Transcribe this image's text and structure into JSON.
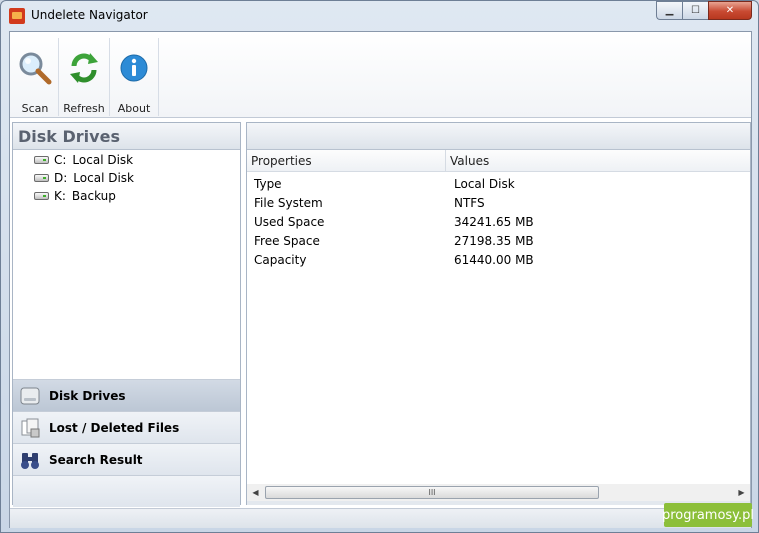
{
  "window": {
    "title": "Undelete Navigator",
    "caption_buttons": {
      "minimize": "▁",
      "maximize": "☐",
      "close": "✕"
    }
  },
  "toolbar": {
    "buttons": [
      {
        "label": "Scan",
        "icon": "magnifier-icon"
      },
      {
        "label": "Refresh",
        "icon": "refresh-icon"
      },
      {
        "label": "About",
        "icon": "info-icon"
      }
    ]
  },
  "left_panel": {
    "header": "Disk Drives",
    "drives": [
      {
        "letter": "C:",
        "name": "Local Disk",
        "icon": "drive-icon"
      },
      {
        "letter": "D:",
        "name": "Local Disk",
        "icon": "drive-icon"
      },
      {
        "letter": "K:",
        "name": "Backup",
        "icon": "drive-icon"
      }
    ],
    "nav": [
      {
        "label": "Disk Drives",
        "icon": "disk-drives-icon",
        "active": true
      },
      {
        "label": "Lost / Deleted Files",
        "icon": "deleted-files-icon",
        "active": false
      },
      {
        "label": "Search Result",
        "icon": "binoculars-icon",
        "active": false
      }
    ]
  },
  "right_panel": {
    "columns": {
      "properties": "Properties",
      "values": "Values"
    },
    "rows": [
      {
        "property": "Type",
        "value": "Local Disk"
      },
      {
        "property": "File System",
        "value": "NTFS"
      },
      {
        "property": "Used Space",
        "value": "34241.65 MB"
      },
      {
        "property": "Free Space",
        "value": "27198.35 MB"
      },
      {
        "property": "Capacity",
        "value": "61440.00 MB"
      }
    ],
    "scrollbar": {
      "left_arrow": "◀",
      "right_arrow": "▶",
      "grip": "III"
    }
  },
  "watermark": "programosy.pl",
  "colors": {
    "accent": "#8cbf3a",
    "title_bar": "#dfe8f2",
    "close_button": "#c84a32"
  }
}
